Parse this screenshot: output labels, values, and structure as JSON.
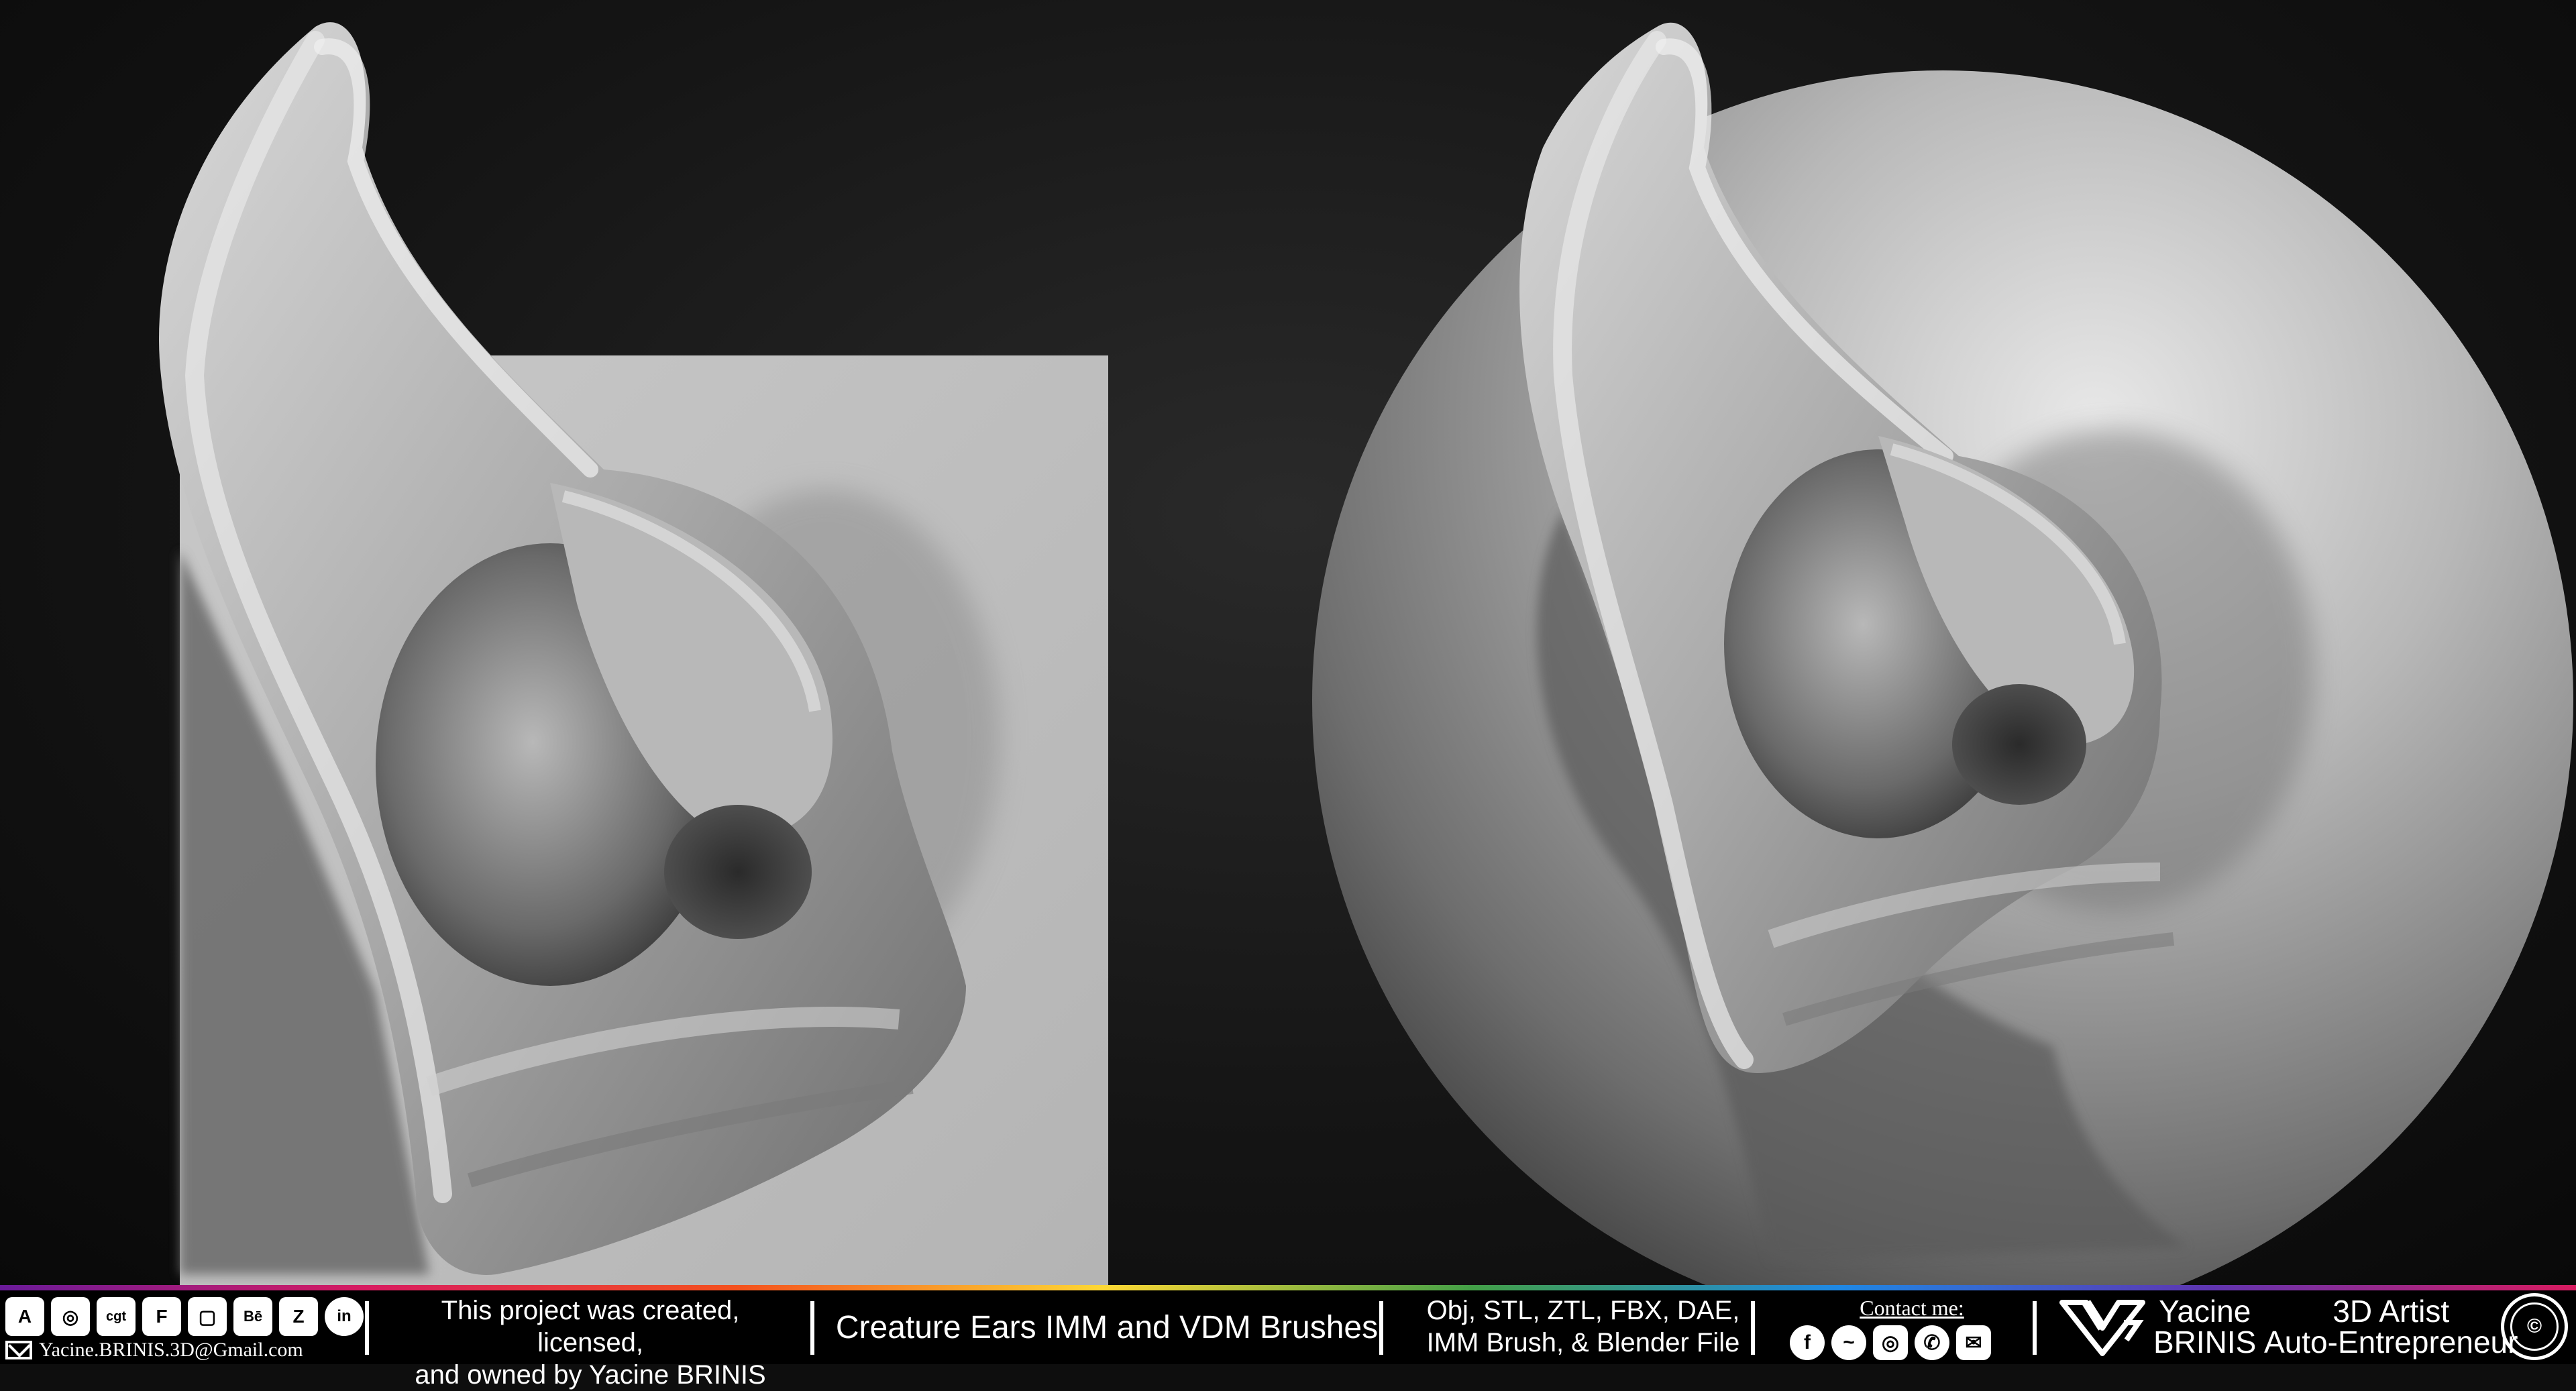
{
  "scene": {
    "left_panel": "ear-on-plane",
    "right_panel": "ear-on-sphere",
    "colors": {
      "background": "#141414",
      "plane": "#bdbdbd",
      "clay_light": "#d6d6d6",
      "clay_mid": "#9a9a9a",
      "clay_dark": "#3d3d3d",
      "shadow": "#5e5e5e"
    }
  },
  "footer": {
    "social_icons": [
      "artstation-icon",
      "sketchfab-icon",
      "cgtrader-icon",
      "fab-icon",
      "store-icon",
      "behance-icon",
      "zbrush-icon",
      "linkedin-icon"
    ],
    "social_labels": [
      "A",
      "◎",
      "cgt",
      "F",
      "▢",
      "Bē",
      "Z",
      "in"
    ],
    "email": "Yacine.BRINIS.3D@Gmail.com",
    "license_line1": "This project was created, licensed,",
    "license_line2": "and owned by Yacine BRINIS",
    "title": "Creature Ears IMM and VDM Brushes",
    "formats_line1": "Obj, STL, ZTL, FBX, DAE,",
    "formats_line2": "IMM Brush, & Blender File",
    "contact_label": "Contact me:",
    "contact_icons": [
      "facebook-icon",
      "messenger-icon",
      "instagram-icon",
      "whatsapp-icon",
      "email-icon"
    ],
    "contact_glyphs": [
      "f",
      "~",
      "◎",
      "✆",
      "✉"
    ],
    "name_line1": "Yacine",
    "name_line2": "BRINIS",
    "role_line1": "3D Artist",
    "role_line2": "Auto-Entrepreneur",
    "copyright": "©"
  }
}
